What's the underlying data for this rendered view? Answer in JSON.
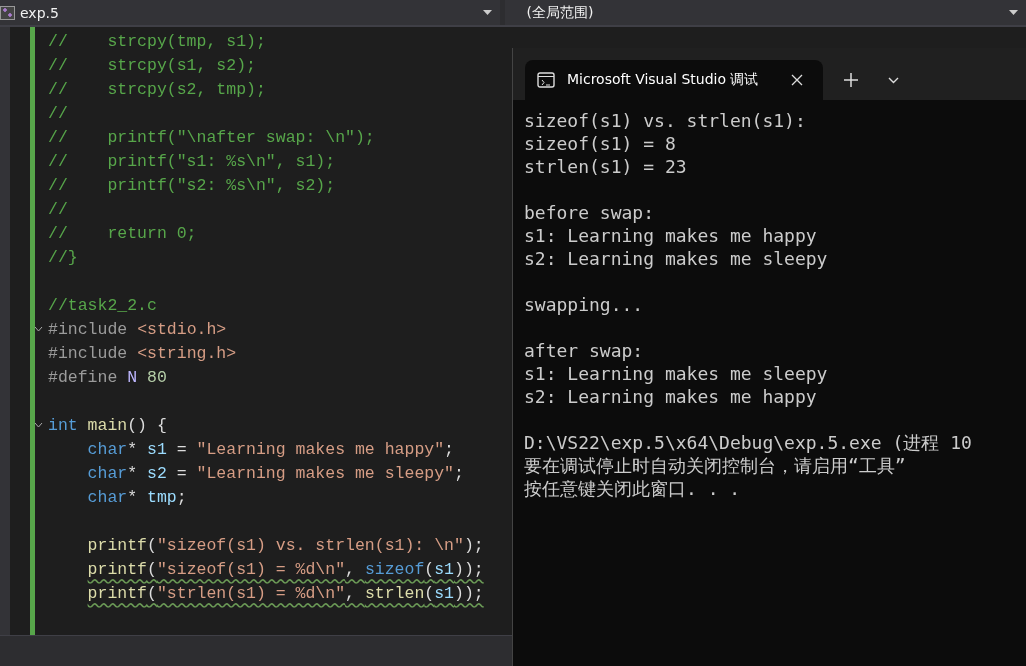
{
  "toolbar": {
    "file_dropdown": "exp.5",
    "scope_dropdown": "(全局范围)"
  },
  "editor": {
    "lines": [
      {
        "kind": "code",
        "tokens": [
          {
            "t": "//    strcpy(tmp, s1);",
            "kind": "comment"
          }
        ]
      },
      {
        "kind": "code",
        "tokens": [
          {
            "t": "//    strcpy(s1, s2);",
            "kind": "comment"
          }
        ]
      },
      {
        "kind": "code",
        "tokens": [
          {
            "t": "//    strcpy(s2, tmp);",
            "kind": "comment"
          }
        ]
      },
      {
        "kind": "code",
        "tokens": [
          {
            "t": "//",
            "kind": "comment"
          }
        ]
      },
      {
        "kind": "code",
        "tokens": [
          {
            "t": "//    printf(\"\\nafter swap: \\n\");",
            "kind": "comment"
          }
        ]
      },
      {
        "kind": "code",
        "tokens": [
          {
            "t": "//    printf(\"s1: %s\\n\", s1);",
            "kind": "comment"
          }
        ]
      },
      {
        "kind": "code",
        "tokens": [
          {
            "t": "//    printf(\"s2: %s\\n\", s2);",
            "kind": "comment"
          }
        ]
      },
      {
        "kind": "code",
        "tokens": [
          {
            "t": "//",
            "kind": "comment"
          }
        ]
      },
      {
        "kind": "code",
        "tokens": [
          {
            "t": "//    return 0;",
            "kind": "comment"
          }
        ]
      },
      {
        "kind": "code",
        "tokens": [
          {
            "t": "//}",
            "kind": "comment"
          }
        ]
      },
      {
        "kind": "blank"
      },
      {
        "kind": "code",
        "tokens": [
          {
            "t": "//task2_2.c",
            "kind": "comment"
          }
        ]
      },
      {
        "kind": "code",
        "fold": true,
        "tokens": [
          {
            "t": "#include ",
            "kind": "preproc"
          },
          {
            "t": "<stdio.h>",
            "kind": "string"
          }
        ]
      },
      {
        "kind": "code",
        "tokens": [
          {
            "t": "#include ",
            "kind": "preproc"
          },
          {
            "t": "<string.h>",
            "kind": "string"
          }
        ]
      },
      {
        "kind": "code",
        "tokens": [
          {
            "t": "#define ",
            "kind": "preproc"
          },
          {
            "t": "N ",
            "kind": "macro"
          },
          {
            "t": "80",
            "kind": "number"
          }
        ]
      },
      {
        "kind": "blank"
      },
      {
        "kind": "code",
        "fold": true,
        "tokens": [
          {
            "t": "int ",
            "kind": "keyword"
          },
          {
            "t": "main",
            "kind": "func"
          },
          {
            "t": "() {",
            "kind": "plain"
          }
        ],
        "children": [
          {
            "kind": "code",
            "tokens": [
              {
                "t": "char",
                "kind": "keyword"
              },
              {
                "t": "* ",
                "kind": "plain"
              },
              {
                "t": "s1",
                "kind": "var"
              },
              {
                "t": " = ",
                "kind": "plain"
              },
              {
                "t": "\"Learning makes me happy\"",
                "kind": "string"
              },
              {
                "t": ";",
                "kind": "plain"
              }
            ]
          },
          {
            "kind": "code",
            "tokens": [
              {
                "t": "char",
                "kind": "keyword"
              },
              {
                "t": "* ",
                "kind": "plain"
              },
              {
                "t": "s2",
                "kind": "var"
              },
              {
                "t": " = ",
                "kind": "plain"
              },
              {
                "t": "\"Learning makes me sleepy\"",
                "kind": "string"
              },
              {
                "t": ";",
                "kind": "plain"
              }
            ]
          },
          {
            "kind": "code",
            "tokens": [
              {
                "t": "char",
                "kind": "keyword"
              },
              {
                "t": "* ",
                "kind": "plain"
              },
              {
                "t": "tmp",
                "kind": "var"
              },
              {
                "t": ";",
                "kind": "plain"
              }
            ]
          },
          {
            "kind": "blank"
          },
          {
            "kind": "code",
            "tokens": [
              {
                "t": "printf",
                "kind": "func"
              },
              {
                "t": "(",
                "kind": "plain"
              },
              {
                "t": "\"sizeof(s1) vs. strlen(s1): \\n\"",
                "kind": "string"
              },
              {
                "t": ");",
                "kind": "plain"
              }
            ]
          },
          {
            "kind": "code",
            "squiggle": true,
            "tokens": [
              {
                "t": "printf",
                "kind": "func"
              },
              {
                "t": "(",
                "kind": "plain"
              },
              {
                "t": "\"sizeof(s1) = %d\\n\"",
                "kind": "string"
              },
              {
                "t": ", ",
                "kind": "plain"
              },
              {
                "t": "sizeof",
                "kind": "keyword"
              },
              {
                "t": "(",
                "kind": "plain"
              },
              {
                "t": "s1",
                "kind": "var"
              },
              {
                "t": "));",
                "kind": "plain"
              }
            ]
          },
          {
            "kind": "code",
            "squiggle": true,
            "tokens": [
              {
                "t": "printf",
                "kind": "func"
              },
              {
                "t": "(",
                "kind": "plain"
              },
              {
                "t": "\"strlen(s1) = %d\\n\"",
                "kind": "string"
              },
              {
                "t": ", ",
                "kind": "plain"
              },
              {
                "t": "strlen",
                "kind": "func"
              },
              {
                "t": "(",
                "kind": "plain"
              },
              {
                "t": "s1",
                "kind": "var"
              },
              {
                "t": "));",
                "kind": "plain"
              }
            ]
          },
          {
            "kind": "blank"
          }
        ]
      }
    ]
  },
  "console": {
    "tab": {
      "title": "Microsoft Visual Studio 调试",
      "selected": true
    },
    "lines": [
      {
        "kind": "text",
        "text": "sizeof(s1) vs. strlen(s1):"
      },
      {
        "kind": "text",
        "text": "sizeof(s1) = 8"
      },
      {
        "kind": "text",
        "text": "strlen(s1) = 23"
      },
      {
        "kind": "blank"
      },
      {
        "kind": "text",
        "text": "before swap:"
      },
      {
        "kind": "text",
        "text": "s1: Learning makes me happy"
      },
      {
        "kind": "text",
        "text": "s2: Learning makes me sleepy"
      },
      {
        "kind": "blank"
      },
      {
        "kind": "text",
        "text": "swapping..."
      },
      {
        "kind": "blank"
      },
      {
        "kind": "text",
        "text": "after swap:"
      },
      {
        "kind": "text",
        "text": "s1: Learning makes me sleepy"
      },
      {
        "kind": "text",
        "text": "s2: Learning makes me happy"
      },
      {
        "kind": "blank"
      },
      {
        "kind": "text",
        "text": "D:\\VS22\\exp.5\\x64\\Debug\\exp.5.exe (进程 10"
      },
      {
        "kind": "text",
        "text": "要在调试停止时自动关闭控制台，请启用“工具”"
      },
      {
        "kind": "text",
        "text": "按任意键关闭此窗口. . ."
      }
    ]
  }
}
